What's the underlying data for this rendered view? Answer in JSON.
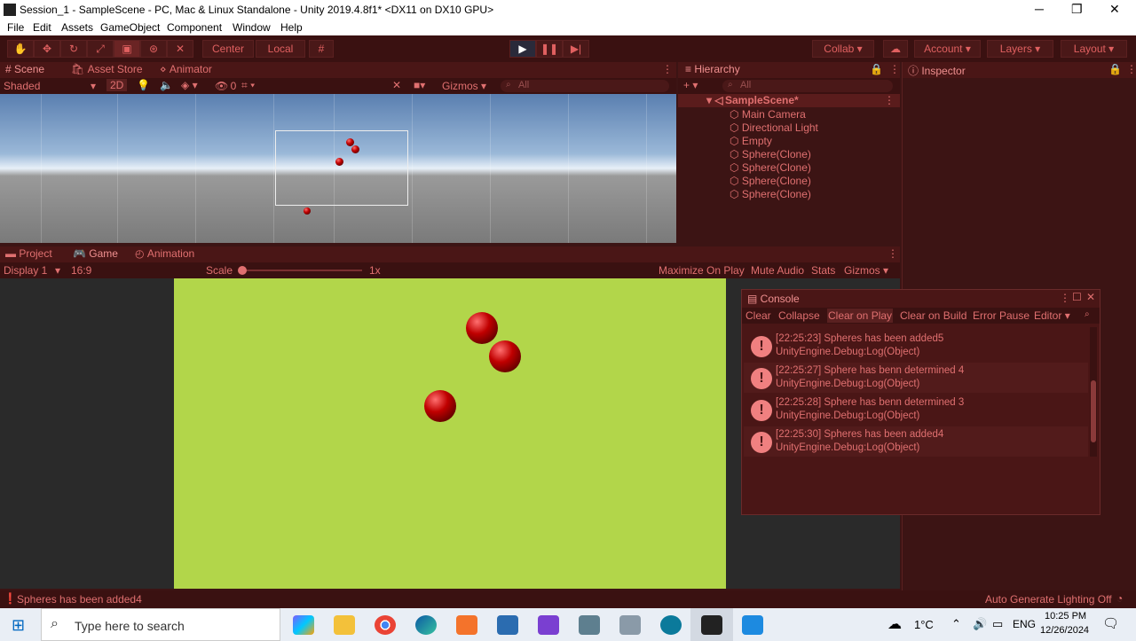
{
  "window": {
    "title": "Session_1 - SampleScene - PC, Mac & Linux Standalone - Unity 2019.4.8f1* <DX11 on DX10 GPU>"
  },
  "menu": [
    "File",
    "Edit",
    "Assets",
    "GameObject",
    "Component",
    "Window",
    "Help"
  ],
  "toolbar": {
    "pivot": "Center",
    "space": "Local",
    "collab": "Collab",
    "account": "Account",
    "layers": "Layers",
    "layout": "Layout"
  },
  "scene_tabs": [
    "Scene",
    "Asset Store",
    "Animator"
  ],
  "scene_toolbar": {
    "shading": "Shaded",
    "mode2d": "2D",
    "hidden_count": "0",
    "gizmos": "Gizmos",
    "search_placeholder": "All"
  },
  "hierarchy": {
    "tab": "Hierarchy",
    "search_placeholder": "All",
    "scene": "SampleScene*",
    "items": [
      "Main Camera",
      "Directional Light",
      "Empty",
      "Sphere(Clone)",
      "Sphere(Clone)",
      "Sphere(Clone)",
      "Sphere(Clone)"
    ]
  },
  "inspector": {
    "tab": "Inspector"
  },
  "bottom_tabs": [
    "Project",
    "Game",
    "Animation"
  ],
  "game_toolbar": {
    "display": "Display 1",
    "aspect": "16:9",
    "scale_label": "Scale",
    "scale_value": "1x",
    "maximize": "Maximize On Play",
    "mute": "Mute Audio",
    "stats": "Stats",
    "gizmos": "Gizmos"
  },
  "console": {
    "tab": "Console",
    "buttons": [
      "Clear",
      "Collapse",
      "Clear on Play",
      "Clear on Build",
      "Error Pause",
      "Editor"
    ],
    "logs": [
      {
        "line1": "[22:25:23] Spheres has been added5",
        "line2": "UnityEngine.Debug:Log(Object)"
      },
      {
        "line1": "[22:25:27] Sphere has benn determined 4",
        "line2": "UnityEngine.Debug:Log(Object)"
      },
      {
        "line1": "[22:25:28] Sphere has benn determined 3",
        "line2": "UnityEngine.Debug:Log(Object)"
      },
      {
        "line1": "[22:25:30] Spheres has been added4",
        "line2": "UnityEngine.Debug:Log(Object)"
      }
    ]
  },
  "status": {
    "message": "Spheres has been added4",
    "lighting": "Auto Generate Lighting Off"
  },
  "taskbar": {
    "search_placeholder": "Type here to search",
    "temperature": "1°C",
    "language": "ENG",
    "time": "10:25 PM",
    "date": "12/26/2024"
  },
  "colors": {
    "editor_tint": "#3c1414",
    "accent": "#e87070",
    "game_background": "#b2d64a"
  }
}
